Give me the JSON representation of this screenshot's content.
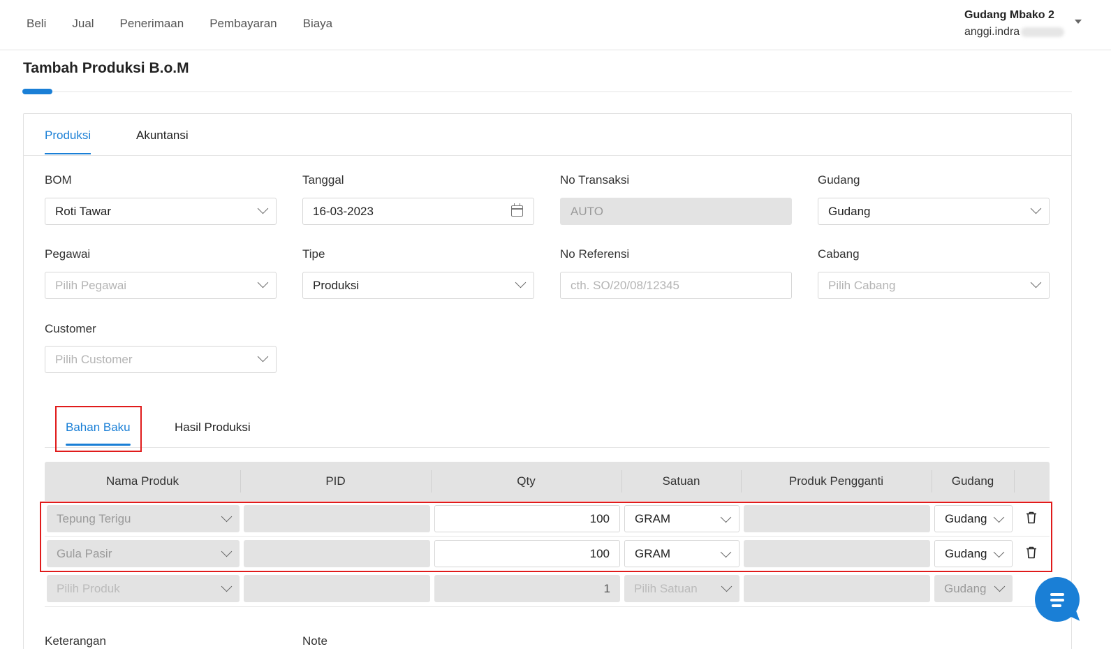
{
  "topnav": {
    "menu": [
      "Beli",
      "Jual",
      "Penerimaan",
      "Pembayaran",
      "Biaya"
    ],
    "store_name": "Gudang Mbako 2",
    "user_email": "anggi.indra"
  },
  "page": {
    "title": "Tambah Produksi B.o.M"
  },
  "tabs": {
    "produksi": "Produksi",
    "akuntansi": "Akuntansi"
  },
  "form": {
    "bom": {
      "label": "BOM",
      "value": "Roti Tawar"
    },
    "tanggal": {
      "label": "Tanggal",
      "value": "16-03-2023"
    },
    "no_transaksi": {
      "label": "No Transaksi",
      "value": "AUTO"
    },
    "gudang": {
      "label": "Gudang",
      "value": "Gudang"
    },
    "pegawai": {
      "label": "Pegawai",
      "placeholder": "Pilih Pegawai"
    },
    "tipe": {
      "label": "Tipe",
      "value": "Produksi"
    },
    "no_referensi": {
      "label": "No Referensi",
      "placeholder": "cth. SO/20/08/12345"
    },
    "cabang": {
      "label": "Cabang",
      "placeholder": "Pilih Cabang"
    },
    "customer": {
      "label": "Customer",
      "placeholder": "Pilih Customer"
    }
  },
  "subtabs": {
    "bahan_baku": "Bahan Baku",
    "hasil_produksi": "Hasil Produksi"
  },
  "table": {
    "headers": [
      "Nama Produk",
      "PID",
      "Qty",
      "Satuan",
      "Produk Pengganti",
      "Gudang"
    ],
    "rows": [
      {
        "produk": "Tepung Terigu",
        "pid": "",
        "qty": "100",
        "satuan": "GRAM",
        "pengganti": "",
        "gudang": "Gudang"
      },
      {
        "produk": "Gula Pasir",
        "pid": "",
        "qty": "100",
        "satuan": "GRAM",
        "pengganti": "",
        "gudang": "Gudang"
      }
    ],
    "new_row": {
      "produk": "Pilih Produk",
      "qty": "1",
      "satuan": "Pilih Satuan",
      "gudang": "Gudang"
    }
  },
  "bottom": {
    "keterangan": "Keterangan",
    "note": "Note"
  },
  "colors": {
    "accent": "#1a7fd6",
    "highlight": "#e01b1b"
  }
}
